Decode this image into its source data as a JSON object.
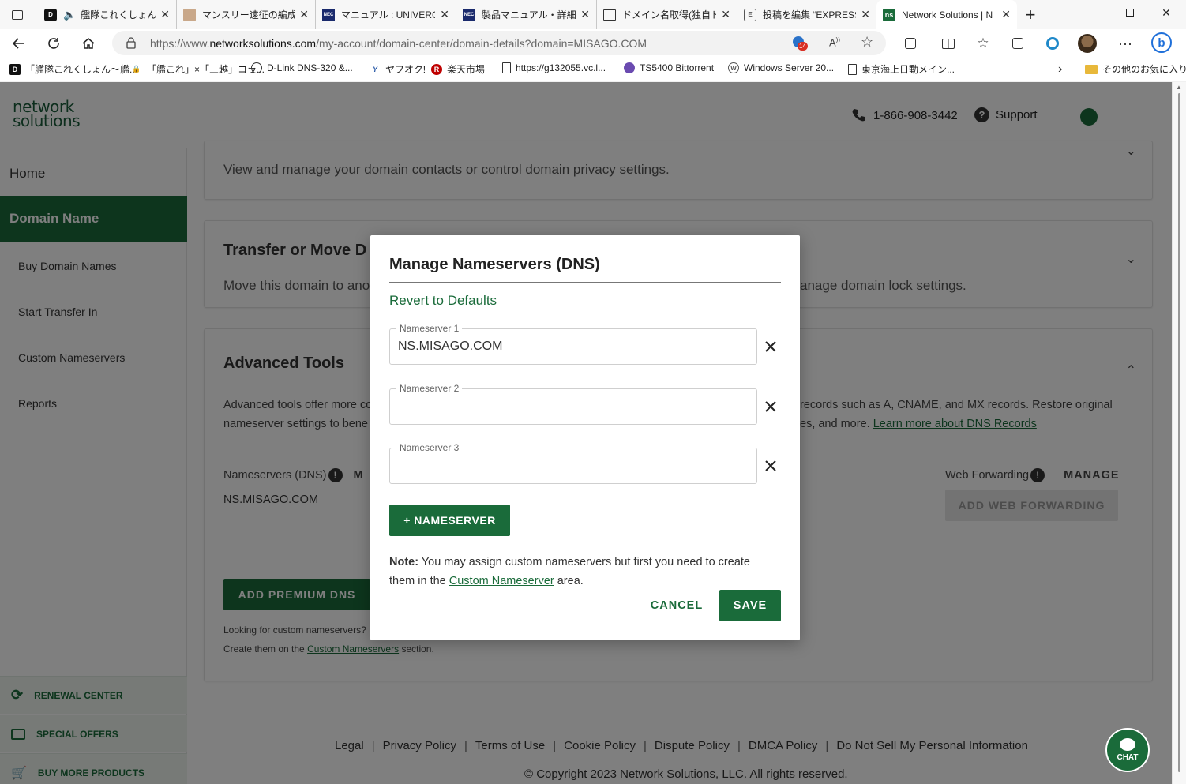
{
  "browser": {
    "tabs": [
      {
        "label": "艦隊これくしょん -艦",
        "favicon": "D"
      },
      {
        "label": "マンスリー遠征の編成",
        "favicon": ""
      },
      {
        "label": "マニュアル : UNIVERGE",
        "favicon": "NEC"
      },
      {
        "label": "製品マニュアル・詳細: ",
        "favicon": "NEC"
      },
      {
        "label": "ドメイン名取得(独自ド",
        "favicon": ""
      },
      {
        "label": "投稿を編集 “EXPRESS",
        "favicon": "E"
      },
      {
        "label": "Network Solutions | N",
        "favicon": "ns"
      }
    ],
    "url_prefix": "https://www.",
    "url_host": "networksolutions.com",
    "url_path": "/my-account/domain-center/domain-details?domain=MISAGO.COM",
    "badge_count": "14",
    "bookmarks": [
      {
        "label": "「艦隊これくしょん～艦...",
        "icon": "D"
      },
      {
        "label": "「艦これ」×「三越」コラ...",
        "icon": ""
      },
      {
        "label": "D-Link DNS-320 &...",
        "icon": ""
      },
      {
        "label": "ヤフオク!",
        "icon": "Y"
      },
      {
        "label": "楽天市場",
        "icon": "R"
      },
      {
        "label": "https://g132055.vc.l...",
        "icon": ""
      },
      {
        "label": "TS5400 Bittorrent",
        "icon": ""
      },
      {
        "label": "Windows Server 20...",
        "icon": "W"
      },
      {
        "label": "東京海上日動メイン...",
        "icon": ""
      }
    ],
    "other_favorites": "その他のお気に入り"
  },
  "header": {
    "logo_line1": "network",
    "logo_line2": "solutions",
    "phone": "1-866-908-3442",
    "support": "Support"
  },
  "sidebar": {
    "items": [
      {
        "label": "Home"
      },
      {
        "label": "Domain Name"
      },
      {
        "label": "Buy Domain Names"
      },
      {
        "label": "Start Transfer In"
      },
      {
        "label": "Custom Nameservers"
      },
      {
        "label": "Reports"
      }
    ],
    "bottom": [
      {
        "label": "RENEWAL CENTER"
      },
      {
        "label": "SPECIAL OFFERS"
      },
      {
        "label": "BUY MORE PRODUCTS"
      }
    ]
  },
  "main": {
    "contacts_desc": "View and manage your domain contacts or control domain privacy settings.",
    "transfer_title": "Transfer or Move D",
    "transfer_desc": "Move this domain to ano",
    "transfer_desc_right": "anage domain lock settings.",
    "advanced_title": "Advanced Tools",
    "advanced_desc_l1": "Advanced tools offer more co",
    "advanced_desc_l1_right": "records such as A, CNAME, and MX records. Restore original",
    "advanced_desc_l2": "nameserver settings to bene",
    "advanced_desc_l2_right": "es, and more.",
    "learn_more": "Learn more about DNS Records",
    "nameservers_label": "Nameservers (DNS)",
    "manage_partial": "M",
    "ns_value": "NS.MISAGO.COM",
    "web_forwarding_label": "Web Forwarding",
    "manage": "MANAGE",
    "add_web_forwarding": "ADD WEB FORWARDING",
    "add_premium_dns": "ADD PREMIUM DNS",
    "looking_custom": "Looking for custom nameservers?",
    "create_them": "Create them on the",
    "custom_ns_link": "Custom Nameservers",
    "section_suffix": "section."
  },
  "footer": {
    "links": [
      "Legal",
      "Privacy Policy",
      "Terms of Use",
      "Cookie Policy",
      "Dispute Policy",
      "DMCA Policy",
      "Do Not Sell My Personal Information"
    ],
    "copyright": "© Copyright 2023 Network Solutions, LLC. All rights reserved."
  },
  "chat": "CHAT",
  "modal": {
    "title": "Manage Nameservers (DNS)",
    "revert": "Revert to Defaults",
    "fields": [
      {
        "label": "Nameserver 1",
        "value": "NS.MISAGO.COM"
      },
      {
        "label": "Nameserver 2",
        "value": ""
      },
      {
        "label": "Nameserver 3",
        "value": ""
      }
    ],
    "add_button": "+ NAMESERVER",
    "note_bold": "Note:",
    "note_text": " You may assign custom nameservers but first you need to create them in the ",
    "note_link": "Custom Nameserver",
    "note_end": " area.",
    "cancel": "CANCEL",
    "save": "SAVE"
  },
  "colors": {
    "brand": "#1a6b3a",
    "overlay": "rgba(0,0,0,0.5)"
  }
}
